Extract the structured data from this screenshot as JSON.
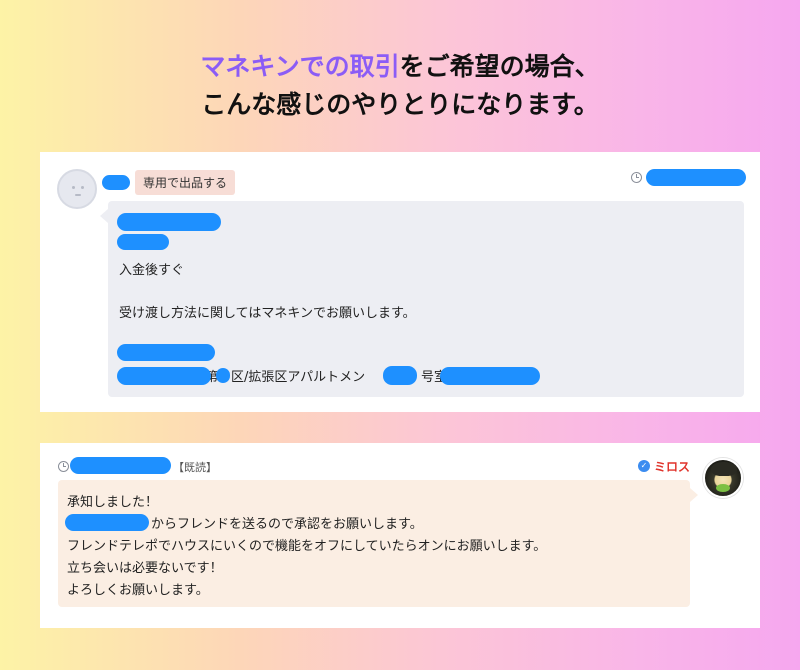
{
  "headline": {
    "line1_accent": "マネキンでの取引",
    "line1_rest": "をご希望の場合、",
    "line2": "こんな感じのやりとりになります。"
  },
  "message1": {
    "badge": "専用で出品する",
    "line_payment": "入金後すぐ",
    "line_handover": "受け渡し方法に関してはマネキンでお願いします。",
    "address_part1": "第",
    "address_part2": "区/拡張区アパルトメン",
    "address_part3": "号室"
  },
  "message2": {
    "read_label": "【既読】",
    "sender_name": "ミロス",
    "line1": "承知しました！",
    "line2_suffix": "からフレンドを送るので承認をお願いします。",
    "line3": "フレンドテレポでハウスにいくので機能をオフにしていたらオンにお願いします。",
    "line4": "立ち会いは必要ないです！",
    "line5": "よろしくお願いします。"
  },
  "icons": {
    "timestamp": "clock-icon",
    "verified": "check-circle-icon",
    "avatar_default": "default-avatar",
    "avatar_character": "character-avatar"
  },
  "colors": {
    "accent_purple": "#8b5cf6",
    "redaction_blue": "#1e90ff",
    "sender_red": "#e0342c",
    "badge_pink": "#f7ddd6",
    "bubble_grey": "#edeef3",
    "bubble_beige": "#fbeee3"
  }
}
